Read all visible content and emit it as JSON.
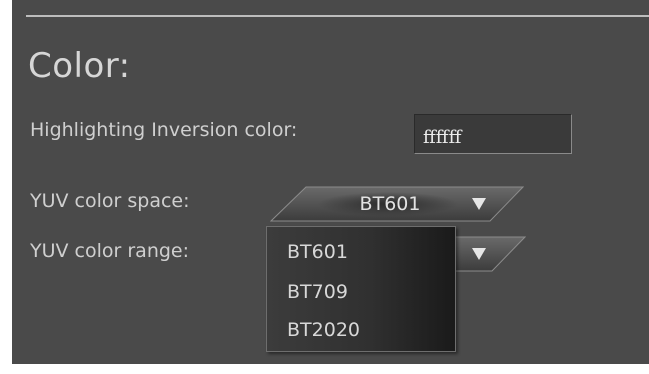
{
  "section": {
    "title": "Color:"
  },
  "highlighting": {
    "label": "Highlighting Inversion color:",
    "value": "ffffff"
  },
  "yuv_color_space": {
    "label": "YUV color space:",
    "selected": "BT601"
  },
  "yuv_color_range": {
    "label": "YUV color range:"
  },
  "dropdown": {
    "options": [
      "BT601",
      "BT709",
      "BT2020"
    ]
  },
  "colors": {
    "panel_background": "#4a4a4a",
    "text": "#cfcfcf",
    "field_background": "#3a3a3a"
  },
  "icons": {
    "combo_arrow": "triangle-down-icon"
  }
}
